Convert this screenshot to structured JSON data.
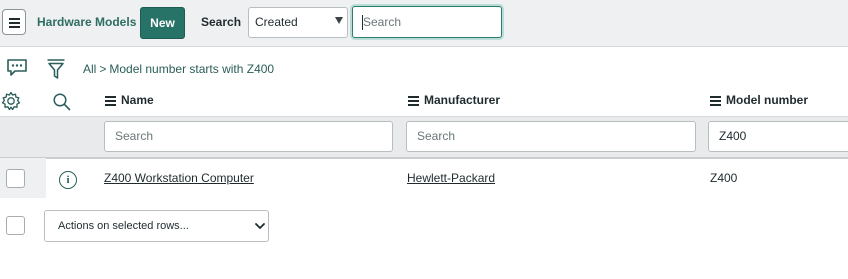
{
  "header": {
    "title": "Hardware Models",
    "new_label": "New",
    "search_label": "Search",
    "search_field_selected": "Created",
    "search_placeholder": "Search"
  },
  "breadcrumb": {
    "all": "All",
    "separator": ">",
    "condition": "Model number starts with Z400"
  },
  "columns": [
    {
      "label": "Name"
    },
    {
      "label": "Manufacturer"
    },
    {
      "label": "Model number"
    }
  ],
  "filters": {
    "name_placeholder": "Search",
    "manufacturer_placeholder": "Search",
    "model_number_value": "Z400"
  },
  "rows": [
    {
      "name": "Z400 Workstation Computer",
      "manufacturer": "Hewlett-Packard",
      "model_number": "Z400"
    }
  ],
  "actions": {
    "selected_label": "Actions on selected rows..."
  },
  "colors": {
    "accent": "#287368",
    "link": "#2a5e59",
    "header_bg": "#eef0f1"
  },
  "icons": [
    "menu-icon",
    "chat-icon",
    "filter-icon",
    "gear-icon",
    "search-icon",
    "info-icon",
    "chevron-down-icon"
  ]
}
